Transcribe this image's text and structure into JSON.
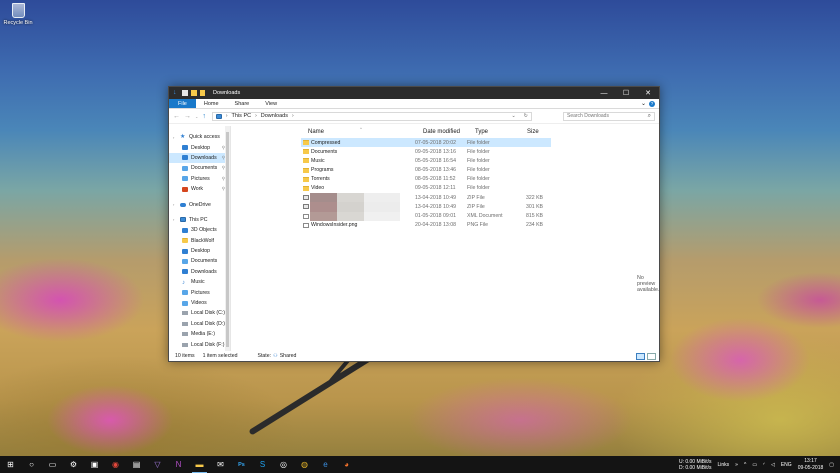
{
  "desktop": {
    "recycle_bin_label": "Recycle Bin"
  },
  "window": {
    "title": "Downloads",
    "controls": {
      "minimize": "—",
      "maximize": "☐",
      "close": "✕"
    },
    "ribbon_tabs": [
      "File",
      "Home",
      "Share",
      "View"
    ],
    "address": {
      "path": [
        "This PC",
        "Downloads"
      ]
    },
    "search": {
      "placeholder": "Search Downloads",
      "icon": "search-icon"
    },
    "nav_pane": {
      "items": [
        {
          "label": "Quick access",
          "icon": "star-icon",
          "head": true
        },
        {
          "label": "Desktop",
          "icon": "desktop-icon",
          "pinned": true
        },
        {
          "label": "Downloads",
          "icon": "downloads-icon",
          "pinned": true,
          "selected": true
        },
        {
          "label": "Documents",
          "icon": "documents-icon",
          "pinned": true
        },
        {
          "label": "Pictures",
          "icon": "pictures-icon",
          "pinned": true
        },
        {
          "label": "Work",
          "icon": "work-icon",
          "pinned": true
        },
        {
          "label": "",
          "icon": "",
          "spacer": true
        },
        {
          "label": "OneDrive",
          "icon": "cloud-icon",
          "head": true
        },
        {
          "label": "",
          "icon": "",
          "spacer": true
        },
        {
          "label": "This PC",
          "icon": "pc-icon",
          "head": true
        },
        {
          "label": "3D Objects",
          "icon": "objects-icon"
        },
        {
          "label": "BlackWolf",
          "icon": "user-folder-icon"
        },
        {
          "label": "Desktop",
          "icon": "desktop-icon"
        },
        {
          "label": "Documents",
          "icon": "documents-icon"
        },
        {
          "label": "Downloads",
          "icon": "downloads-icon"
        },
        {
          "label": "Music",
          "icon": "music-icon"
        },
        {
          "label": "Pictures",
          "icon": "pictures-icon"
        },
        {
          "label": "Videos",
          "icon": "videos-icon"
        },
        {
          "label": "Local Disk (C:)",
          "icon": "drive-icon"
        },
        {
          "label": "Local Disk (D:)",
          "icon": "drive-icon"
        },
        {
          "label": "Media (E:)",
          "icon": "drive-icon"
        },
        {
          "label": "Local Disk (F:)",
          "icon": "drive-icon"
        }
      ]
    },
    "columns": {
      "name": "Name",
      "date": "Date modified",
      "type": "Type",
      "size": "Size"
    },
    "files": [
      {
        "name": "Compressed",
        "date": "07-05-2018 20:02",
        "type": "File folder",
        "size": "",
        "icon": "folder-icon",
        "selected": true
      },
      {
        "name": "Documents",
        "date": "09-05-2018 13:16",
        "type": "File folder",
        "size": "",
        "icon": "folder-icon"
      },
      {
        "name": "Music",
        "date": "05-05-2018 16:54",
        "type": "File folder",
        "size": "",
        "icon": "folder-icon"
      },
      {
        "name": "Programs",
        "date": "08-05-2018 13:46",
        "type": "File folder",
        "size": "",
        "icon": "folder-icon"
      },
      {
        "name": "Torrents",
        "date": "08-05-2018 11:52",
        "type": "File folder",
        "size": "",
        "icon": "folder-icon"
      },
      {
        "name": "Video",
        "date": "09-05-2018 12:11",
        "type": "File folder",
        "size": "",
        "icon": "folder-icon"
      },
      {
        "name": "",
        "date": "13-04-2018 10:49",
        "type": "ZIP File",
        "size": "322 KB",
        "icon": "zip-icon",
        "blurred": true
      },
      {
        "name": "",
        "date": "13-04-2018 10:49",
        "type": "ZIP File",
        "size": "301 KB",
        "icon": "zip-icon",
        "blurred": true
      },
      {
        "name": "",
        "date": "01-05-2018 09:01",
        "type": "XML Document",
        "size": "815 KB",
        "icon": "xml-icon",
        "blurred": true
      },
      {
        "name": "WindowsInsider.png",
        "date": "20-04-2018 13:08",
        "type": "PNG File",
        "size": "234 KB",
        "icon": "image-icon"
      }
    ],
    "preview": "No preview available.",
    "status": {
      "items": "10 items",
      "selected": "1 item selected",
      "state_label": "State:",
      "state_value": "Shared"
    }
  },
  "taskbar": {
    "apps": [
      "start",
      "cortana",
      "task-view",
      "settings",
      "store",
      "groove",
      "photos",
      "vs",
      "onenote",
      "explorer",
      "mail",
      "photoshop",
      "skype",
      "media",
      "chrome",
      "edge",
      "firefox"
    ],
    "network": {
      "up_label": "U:",
      "up_value": "0.00 MiBit/s",
      "down_label": "D:",
      "down_value": "0.00 MiBit/s"
    },
    "links_label": "Links",
    "language": "ENG",
    "time": "13:17",
    "date": "09-05-2018"
  }
}
